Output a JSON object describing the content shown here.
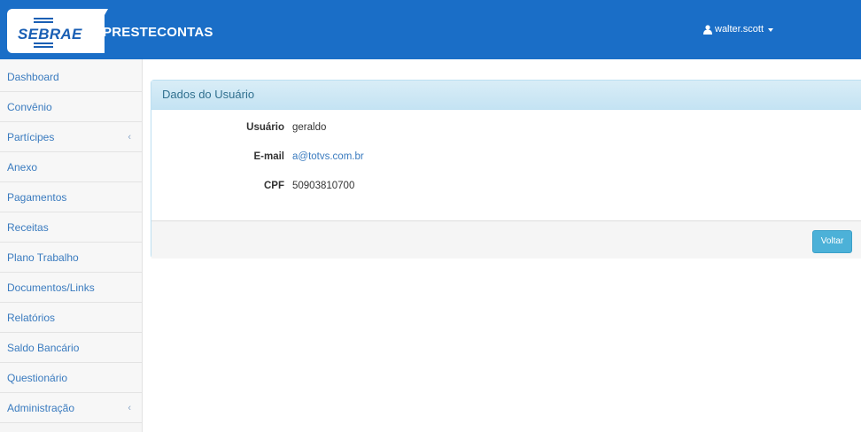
{
  "header": {
    "logo_text": "SEBRAE",
    "app_title": "PRESTECONTAS",
    "user_name": "walter.scott"
  },
  "sidebar": {
    "items": [
      {
        "label": "Dashboard",
        "has_submenu": false
      },
      {
        "label": "Convênio",
        "has_submenu": false
      },
      {
        "label": "Partícipes",
        "has_submenu": true
      },
      {
        "label": "Anexo",
        "has_submenu": false
      },
      {
        "label": "Pagamentos",
        "has_submenu": false
      },
      {
        "label": "Receitas",
        "has_submenu": false
      },
      {
        "label": "Plano Trabalho",
        "has_submenu": false
      },
      {
        "label": "Documentos/Links",
        "has_submenu": false
      },
      {
        "label": "Relatórios",
        "has_submenu": false
      },
      {
        "label": "Saldo Bancário",
        "has_submenu": false
      },
      {
        "label": "Questionário",
        "has_submenu": false
      },
      {
        "label": "Administração",
        "has_submenu": true
      }
    ],
    "submenu_chevron": "‹"
  },
  "panel": {
    "title": "Dados do Usuário",
    "fields": [
      {
        "label": "Usuário",
        "value": "geraldo"
      },
      {
        "label": "E-mail",
        "value": "a@totvs.com.br"
      },
      {
        "label": "CPF",
        "value": "50903810700"
      }
    ],
    "back_button": "Voltar"
  },
  "colors": {
    "navbar": "#1a6ec7",
    "link": "#3a7bbf",
    "panel_heading": "#d9edf7",
    "button": "#4cb1d8"
  }
}
